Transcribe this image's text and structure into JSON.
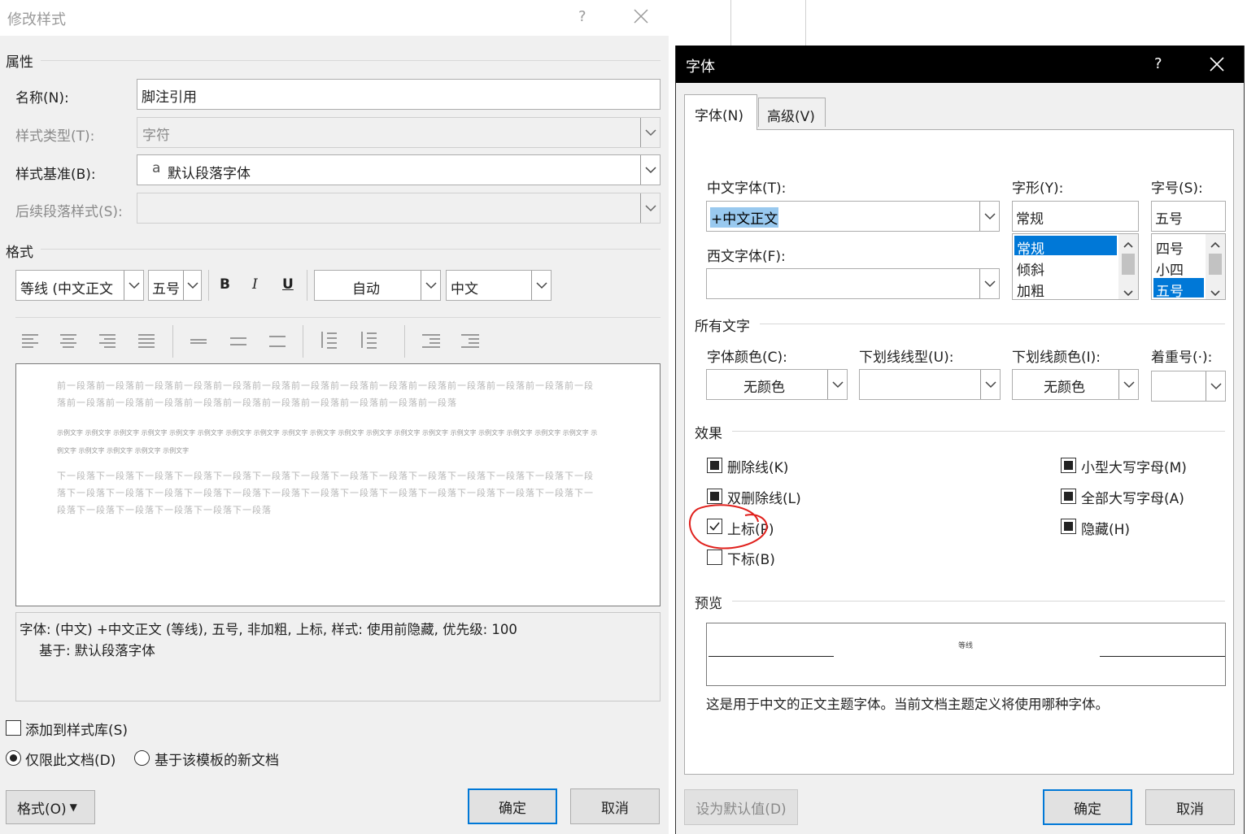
{
  "left_dialog": {
    "title": "修改样式",
    "help": "?",
    "close": "✕",
    "properties_header": "属性",
    "name_label": "名称(N):",
    "name_value": "脚注引用",
    "style_type_label": "样式类型(T):",
    "style_type_value": "字符",
    "style_based_label": "样式基准(B):",
    "style_based_prefix": "a",
    "style_based_value": "默认段落字体",
    "next_para_label": "后续段落样式(S):",
    "next_para_value": "",
    "format_header": "格式",
    "font_value": "等线 (中文正文",
    "size_value": "五号",
    "bold": "B",
    "italic": "I",
    "underline": "U",
    "color_value": "自动",
    "lang_value": "中文",
    "preview_prev": "前一段落前一段落前一段落前一段落前一段落前一段落前一段落前一段落前一段落前一段落前一段落前一段落前一段落前一段落前一段落前一段落前一段落前一段落前一段落前一段落前一段落前一段落前一段落前一段落",
    "preview_sample": "示例文字 示例文字 示例文字 示例文字 示例文字 示例文字 示例文字 示例文字 示例文字 示例文字 示例文字 示例文字 示例文字 示例文字 示例文字 示例文字 示例文字 示例文字 示例文字 示例文字 示例文字 示例文字 示例文字 示例文字",
    "preview_next": "下一段落下一段落下一段落下一段落下一段落下一段落下一段落下一段落下一段落下一段落下一段落下一段落下一段落下一段落下一段落下一段落下一段落下一段落下一段落下一段落下一段落下一段落下一段落下一段落下一段落下一段落下一段落下一段落下一段落下一段落下一段落下一段落下一段落",
    "description_line1": "字体: (中文) +中文正文 (等线), 五号, 非加粗, 上标, 样式: 使用前隐藏, 优先级: 100",
    "description_line2": "基于: 默认段落字体",
    "add_to_gallery": "添加到样式库(S)",
    "only_this_doc": "仅限此文档(D)",
    "new_docs_template": "基于该模板的新文档",
    "format_button": "格式(O)",
    "ok": "确定",
    "cancel": "取消"
  },
  "right_dialog": {
    "title": "字体",
    "help": "?",
    "close": "✕",
    "tab_font": "字体(N)",
    "tab_advanced": "高级(V)",
    "cn_font_label": "中文字体(T):",
    "cn_font_value": "+中文正文",
    "style_label": "字形(Y):",
    "style_value": "常规",
    "style_options": [
      "常规",
      "倾斜",
      "加粗"
    ],
    "size_label": "字号(S):",
    "size_value": "五号",
    "size_options": [
      "四号",
      "小四",
      "五号"
    ],
    "western_font_label": "西文字体(F):",
    "western_font_value": "",
    "all_text_header": "所有文字",
    "font_color_label": "字体颜色(C):",
    "font_color_value": "无颜色",
    "underline_type_label": "下划线线型(U):",
    "underline_type_value": "",
    "underline_color_label": "下划线颜色(I):",
    "underline_color_value": "无颜色",
    "emphasis_label": "着重号(·):",
    "emphasis_value": "",
    "effects_header": "效果",
    "strikethrough": "删除线(K)",
    "double_strikethrough": "双删除线(L)",
    "superscript": "上标(P)",
    "subscript": "下标(B)",
    "small_caps": "小型大写字母(M)",
    "all_caps": "全部大写字母(A)",
    "hidden": "隐藏(H)",
    "preview_header": "预览",
    "preview_sample": "等线",
    "preview_note": "这是用于中文的正文主题字体。当前文档主题定义将使用哪种字体。",
    "set_default": "设为默认值(D)",
    "ok": "确定",
    "cancel": "取消"
  },
  "colors": {
    "accent": "#0078d7",
    "selection": "#0078d7",
    "annotation_red": "#e0201c",
    "titlebar_dark": "#000000"
  }
}
